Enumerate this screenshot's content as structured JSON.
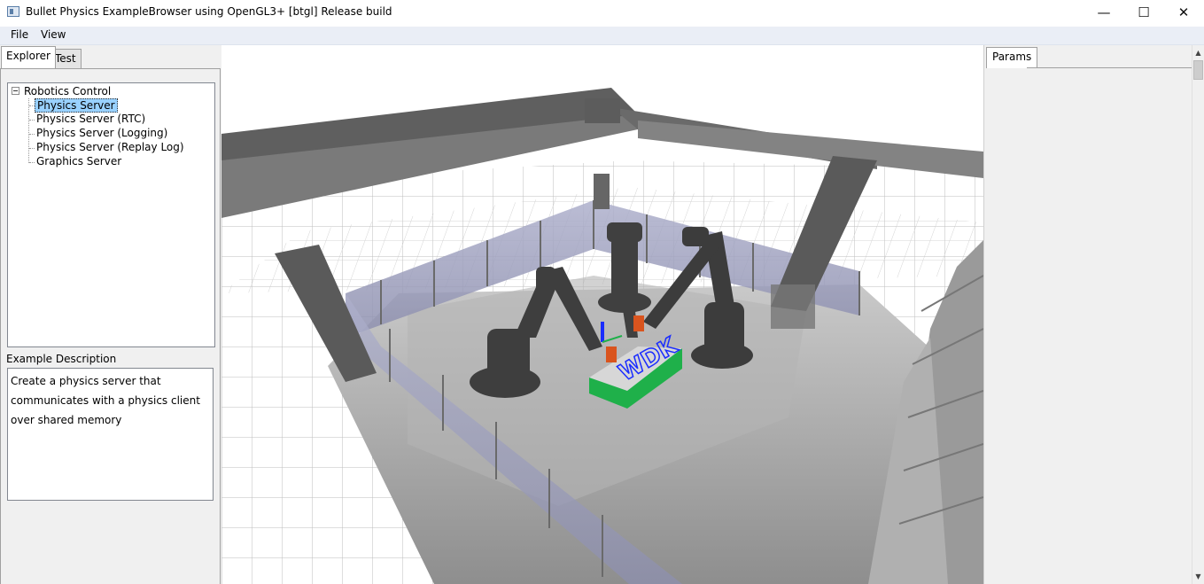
{
  "window": {
    "title": "Bullet Physics ExampleBrowser using OpenGL3+ [btgl] Release build",
    "controls": {
      "minimize": "—",
      "maximize": "☐",
      "close": "✕"
    }
  },
  "menu": {
    "file": "File",
    "view": "View"
  },
  "left_panel": {
    "tabs": [
      {
        "label": "Explorer",
        "active": true
      },
      {
        "label": "Test",
        "active": false
      }
    ],
    "tree": {
      "root": "Robotics Control",
      "items": [
        {
          "label": "Physics Server",
          "selected": true
        },
        {
          "label": "Physics Server (RTC)",
          "selected": false
        },
        {
          "label": "Physics Server (Logging)",
          "selected": false
        },
        {
          "label": "Physics Server (Replay Log)",
          "selected": false
        },
        {
          "label": "Graphics Server",
          "selected": false
        }
      ]
    },
    "description_label": "Example Description",
    "description_lines": [
      "Create a physics server that",
      "communicates with a physics client",
      "over shared memory"
    ]
  },
  "viewport": {
    "sign_text": "WDK"
  },
  "right_panel": {
    "tab_label": "Params"
  },
  "colors": {
    "selection": "#99d1ff",
    "workpiece_top": "#d7d7d7",
    "workpiece_side": "#1fb04a",
    "axis_blue": "#1a2cff",
    "gripper": "#d9541e"
  }
}
